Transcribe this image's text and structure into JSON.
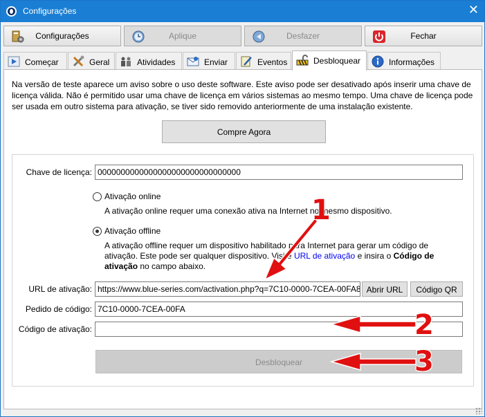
{
  "window": {
    "title": "Configurações",
    "close_glyph": "✕"
  },
  "toolbar": {
    "configuracoes": "Configurações",
    "aplique": "Aplique",
    "desfazer": "Desfazer",
    "fechar": "Fechar"
  },
  "tabs": [
    {
      "label": "Começar",
      "icon": "play-icon"
    },
    {
      "label": "Geral",
      "icon": "tools-icon"
    },
    {
      "label": "Atividades",
      "icon": "people-icon"
    },
    {
      "label": "Enviar",
      "icon": "send-icon"
    },
    {
      "label": "Eventos",
      "icon": "notepad-icon"
    },
    {
      "label": "Desbloquear",
      "icon": "unlock-icon",
      "active": true
    },
    {
      "label": "Informações",
      "icon": "info-icon"
    }
  ],
  "intro": {
    "line1": "Na versão de teste aparece um aviso sobre o uso deste software. Este aviso pode ser desativado após inserir uma chave de",
    "line2": "licença válida. Não é permitido usar uma chave de licença em vários sistemas ao mesmo tempo. Uma chave de licença pode",
    "line3": "ser usada em outro sistema para ativação, se tiver sido removido anteriormente de uma instalação existente."
  },
  "buy_button": "Compre Agora",
  "license": {
    "label": "Chave de licença:",
    "value": "0000000000000000000000000000000"
  },
  "online": {
    "label": "Ativação online",
    "desc": "A ativação online requer uma conexão ativa na Internet no mesmo dispositivo."
  },
  "offline": {
    "label": "Ativação offline",
    "desc_line1": "A ativação offline requer um dispositivo habilitado para Internet para gerar um código de",
    "desc_line2_a": "ativação. Este pode ser qualquer dispositivo. Visite",
    "desc_link": "URL de ativação",
    "desc_line2_b": "e insira o",
    "desc_bold1": "Código de",
    "desc_bold2": "ativação",
    "desc_line3": "no campo abaixo."
  },
  "activation_url": {
    "label": "URL de ativação:",
    "value": "https://www.blue-series.com/activation.php?q=7C10-0000-7CEA-00FA8",
    "open_button": "Abrir URL",
    "qr_button": "Código QR"
  },
  "request_code": {
    "label": "Pedido de código:",
    "value": "7C10-0000-7CEA-00FA"
  },
  "activation_code": {
    "label": "Código de ativação:",
    "value": ""
  },
  "unlock_button": "Desbloquear",
  "annotations": {
    "n1": "1",
    "n2": "2",
    "n3": "3",
    "color": "#e01010"
  },
  "colors": {
    "titlebar": "#1a7fd4",
    "fechar_icon": "#d9262b",
    "link": "#0000ee"
  }
}
